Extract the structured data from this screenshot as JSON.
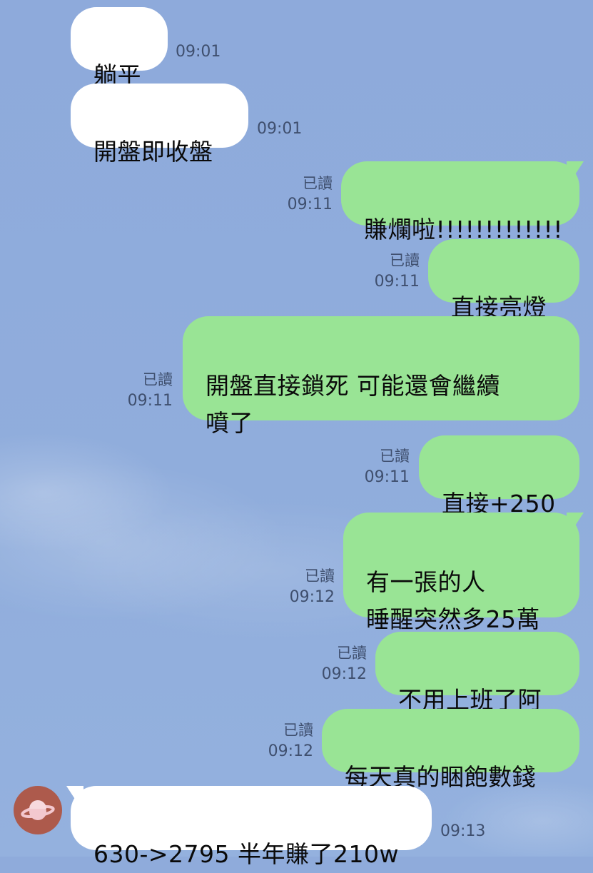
{
  "messages": [
    {
      "side": "in",
      "text": "躺平",
      "time": "09:01"
    },
    {
      "side": "in",
      "text": "開盤即收盤",
      "time": "09:01"
    },
    {
      "side": "out",
      "text": "賺爛啦!!!!!!!!!!!!!",
      "read": "已讀",
      "time": "09:11"
    },
    {
      "side": "out",
      "text": "直接亮燈",
      "read": "已讀",
      "time": "09:11"
    },
    {
      "side": "out",
      "text": "開盤直接鎖死 可能還會繼續\n噴了",
      "read": "已讀",
      "time": "09:11"
    },
    {
      "side": "out",
      "text": "直接+250",
      "read": "已讀",
      "time": "09:11"
    },
    {
      "side": "out",
      "text": "有一張的人\n睡醒突然多25萬",
      "read": "已讀",
      "time": "09:12"
    },
    {
      "side": "out",
      "text": "不用上班了阿",
      "read": "已讀",
      "time": "09:12"
    },
    {
      "side": "out",
      "text": "每天真的睏飽數錢",
      "read": "已讀",
      "time": "09:12"
    },
    {
      "side": "in",
      "text": "630->2795 半年賺了210w",
      "time": "09:13"
    }
  ],
  "colors": {
    "background": "#8fabdb",
    "outgoing_bubble": "#99e495",
    "incoming_bubble": "#ffffff",
    "avatar": "#ad5a4c",
    "avatar_planet": "#f3c8cf"
  },
  "icons": {
    "avatar": "planet-icon"
  }
}
